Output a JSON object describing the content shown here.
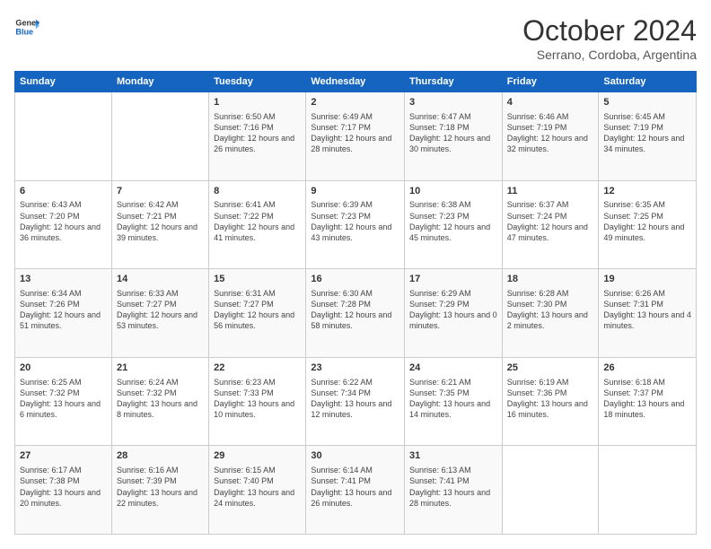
{
  "header": {
    "logo": {
      "line1": "General",
      "line2": "Blue"
    },
    "title": "October 2024",
    "subtitle": "Serrano, Cordoba, Argentina"
  },
  "days_of_week": [
    "Sunday",
    "Monday",
    "Tuesday",
    "Wednesday",
    "Thursday",
    "Friday",
    "Saturday"
  ],
  "weeks": [
    [
      {
        "day": "",
        "info": ""
      },
      {
        "day": "",
        "info": ""
      },
      {
        "day": "1",
        "info": "Sunrise: 6:50 AM\nSunset: 7:16 PM\nDaylight: 12 hours\nand 26 minutes."
      },
      {
        "day": "2",
        "info": "Sunrise: 6:49 AM\nSunset: 7:17 PM\nDaylight: 12 hours\nand 28 minutes."
      },
      {
        "day": "3",
        "info": "Sunrise: 6:47 AM\nSunset: 7:18 PM\nDaylight: 12 hours\nand 30 minutes."
      },
      {
        "day": "4",
        "info": "Sunrise: 6:46 AM\nSunset: 7:19 PM\nDaylight: 12 hours\nand 32 minutes."
      },
      {
        "day": "5",
        "info": "Sunrise: 6:45 AM\nSunset: 7:19 PM\nDaylight: 12 hours\nand 34 minutes."
      }
    ],
    [
      {
        "day": "6",
        "info": "Sunrise: 6:43 AM\nSunset: 7:20 PM\nDaylight: 12 hours\nand 36 minutes."
      },
      {
        "day": "7",
        "info": "Sunrise: 6:42 AM\nSunset: 7:21 PM\nDaylight: 12 hours\nand 39 minutes."
      },
      {
        "day": "8",
        "info": "Sunrise: 6:41 AM\nSunset: 7:22 PM\nDaylight: 12 hours\nand 41 minutes."
      },
      {
        "day": "9",
        "info": "Sunrise: 6:39 AM\nSunset: 7:23 PM\nDaylight: 12 hours\nand 43 minutes."
      },
      {
        "day": "10",
        "info": "Sunrise: 6:38 AM\nSunset: 7:23 PM\nDaylight: 12 hours\nand 45 minutes."
      },
      {
        "day": "11",
        "info": "Sunrise: 6:37 AM\nSunset: 7:24 PM\nDaylight: 12 hours\nand 47 minutes."
      },
      {
        "day": "12",
        "info": "Sunrise: 6:35 AM\nSunset: 7:25 PM\nDaylight: 12 hours\nand 49 minutes."
      }
    ],
    [
      {
        "day": "13",
        "info": "Sunrise: 6:34 AM\nSunset: 7:26 PM\nDaylight: 12 hours\nand 51 minutes."
      },
      {
        "day": "14",
        "info": "Sunrise: 6:33 AM\nSunset: 7:27 PM\nDaylight: 12 hours\nand 53 minutes."
      },
      {
        "day": "15",
        "info": "Sunrise: 6:31 AM\nSunset: 7:27 PM\nDaylight: 12 hours\nand 56 minutes."
      },
      {
        "day": "16",
        "info": "Sunrise: 6:30 AM\nSunset: 7:28 PM\nDaylight: 12 hours\nand 58 minutes."
      },
      {
        "day": "17",
        "info": "Sunrise: 6:29 AM\nSunset: 7:29 PM\nDaylight: 13 hours\nand 0 minutes."
      },
      {
        "day": "18",
        "info": "Sunrise: 6:28 AM\nSunset: 7:30 PM\nDaylight: 13 hours\nand 2 minutes."
      },
      {
        "day": "19",
        "info": "Sunrise: 6:26 AM\nSunset: 7:31 PM\nDaylight: 13 hours\nand 4 minutes."
      }
    ],
    [
      {
        "day": "20",
        "info": "Sunrise: 6:25 AM\nSunset: 7:32 PM\nDaylight: 13 hours\nand 6 minutes."
      },
      {
        "day": "21",
        "info": "Sunrise: 6:24 AM\nSunset: 7:32 PM\nDaylight: 13 hours\nand 8 minutes."
      },
      {
        "day": "22",
        "info": "Sunrise: 6:23 AM\nSunset: 7:33 PM\nDaylight: 13 hours\nand 10 minutes."
      },
      {
        "day": "23",
        "info": "Sunrise: 6:22 AM\nSunset: 7:34 PM\nDaylight: 13 hours\nand 12 minutes."
      },
      {
        "day": "24",
        "info": "Sunrise: 6:21 AM\nSunset: 7:35 PM\nDaylight: 13 hours\nand 14 minutes."
      },
      {
        "day": "25",
        "info": "Sunrise: 6:19 AM\nSunset: 7:36 PM\nDaylight: 13 hours\nand 16 minutes."
      },
      {
        "day": "26",
        "info": "Sunrise: 6:18 AM\nSunset: 7:37 PM\nDaylight: 13 hours\nand 18 minutes."
      }
    ],
    [
      {
        "day": "27",
        "info": "Sunrise: 6:17 AM\nSunset: 7:38 PM\nDaylight: 13 hours\nand 20 minutes."
      },
      {
        "day": "28",
        "info": "Sunrise: 6:16 AM\nSunset: 7:39 PM\nDaylight: 13 hours\nand 22 minutes."
      },
      {
        "day": "29",
        "info": "Sunrise: 6:15 AM\nSunset: 7:40 PM\nDaylight: 13 hours\nand 24 minutes."
      },
      {
        "day": "30",
        "info": "Sunrise: 6:14 AM\nSunset: 7:41 PM\nDaylight: 13 hours\nand 26 minutes."
      },
      {
        "day": "31",
        "info": "Sunrise: 6:13 AM\nSunset: 7:41 PM\nDaylight: 13 hours\nand 28 minutes."
      },
      {
        "day": "",
        "info": ""
      },
      {
        "day": "",
        "info": ""
      }
    ]
  ]
}
